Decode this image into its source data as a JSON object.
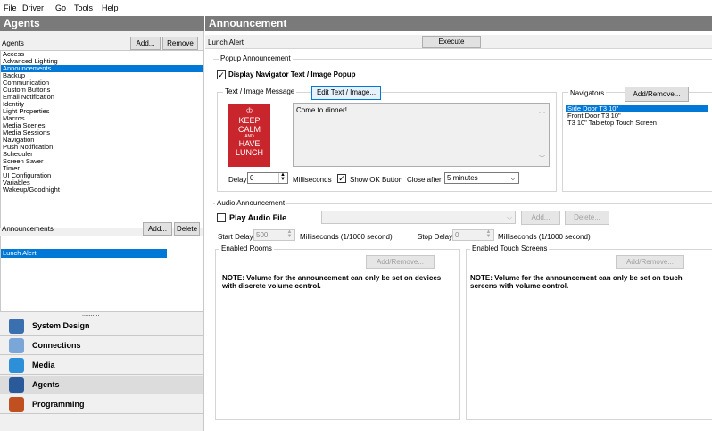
{
  "menu": [
    "File",
    "Driver",
    "Go",
    "Tools",
    "Help"
  ],
  "left": {
    "title": "Agents",
    "agents_header": "Agents",
    "add_label": "Add...",
    "remove_label": "Remove",
    "agents": [
      "Access",
      "Advanced Lighting",
      "Announcements",
      "Backup",
      "Communication",
      "Custom Buttons",
      "Email Notification",
      "Identity",
      "Light Properties",
      "Macros",
      "Media Scenes",
      "Media Sessions",
      "Navigation",
      "Push Notification",
      "Scheduler",
      "Screen Saver",
      "Timer",
      "UI Configuration",
      "Variables",
      "Wakeup/Goodnight"
    ],
    "selected_agent": "Announcements",
    "ann_header": "Announcements",
    "ann_add_label": "Add...",
    "ann_delete_label": "Delete",
    "announcements": [
      "Lunch Alert"
    ],
    "dots": "..........",
    "nav": [
      {
        "label": "System Design",
        "icon": "system-design-icon",
        "color": "#3a6fb0"
      },
      {
        "label": "Connections",
        "icon": "connections-icon",
        "color": "#7aa7d8"
      },
      {
        "label": "Media",
        "icon": "media-icon",
        "color": "#2d8fd8"
      },
      {
        "label": "Agents",
        "icon": "agents-icon",
        "color": "#2a5a9a"
      },
      {
        "label": "Programming",
        "icon": "programming-icon",
        "color": "#c05020"
      }
    ]
  },
  "right": {
    "title": "Announcement",
    "alert_name": "Lunch Alert",
    "execute_label": "Execute",
    "popup_group": "Popup Announcement",
    "display_popup_label": "Display Navigator Text / Image Popup",
    "display_popup_checked": true,
    "text_image_group": "Text / Image Message",
    "edit_text_label": "Edit Text / Image...",
    "poster": [
      "KEEP",
      "CALM",
      "AND",
      "HAVE",
      "LUNCH"
    ],
    "message": "Come to dinner!",
    "delay_label": "Delay",
    "delay_value": "0",
    "milliseconds_label": "Milliseconds",
    "show_ok_label": "Show OK Button",
    "show_ok_checked": true,
    "close_after_label": "Close after",
    "close_after_value": "5 minutes",
    "navigators_group": "Navigators",
    "nav_add_remove_label": "Add/Remove...",
    "navigators": [
      "Side Door T3 10\"",
      "Front Door T3 10\"",
      "T3 10\" Tabletop Touch Screen"
    ],
    "selected_navigator": "Side Door T3 10\"",
    "audio_group": "Audio Announcement",
    "play_audio_label": "Play Audio File",
    "audio_add_label": "Add...",
    "audio_delete_label": "Delete...",
    "start_delay_label": "Start Delay",
    "start_delay_value": "500",
    "ms_1000_label": "Milliseconds (1/1000 second)",
    "stop_delay_label": "Stop Delay",
    "stop_delay_value": "0",
    "ms_1000_label2": "Milliseconds (1/1000 second)",
    "rooms_group": "Enabled Rooms",
    "rooms_add_remove": "Add/Remove...",
    "rooms_note": "NOTE: Volume for the announcement can only be set on devices with discrete volume control.",
    "touch_group": "Enabled Touch Screens",
    "touch_add_remove": "Add/Remove...",
    "touch_note": "NOTE: Volume for the announcement can only be set on touch screens with volume control."
  },
  "colors": {
    "panel_title": "#7a7a7a",
    "selection": "#0078d7",
    "poster_red": "#c8262c"
  }
}
